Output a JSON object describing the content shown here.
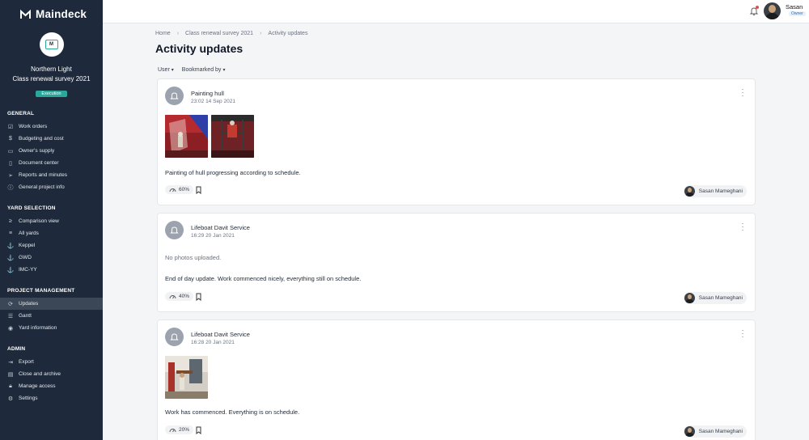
{
  "app": {
    "brand": "Maindeck"
  },
  "project": {
    "ship": "Northern Light",
    "name": "Class renewal survey 2021",
    "status": "Execution",
    "avatar_letter": "M"
  },
  "sidebar": {
    "sections": [
      {
        "heading": "GENERAL",
        "items": [
          {
            "label": "Work orders",
            "icon": "checkbox-icon"
          },
          {
            "label": "Budgeting and cost",
            "icon": "dollar-icon"
          },
          {
            "label": "Owner's supply",
            "icon": "truck-icon"
          },
          {
            "label": "Document center",
            "icon": "folder-icon"
          },
          {
            "label": "Reports and minutes",
            "icon": "send-icon"
          },
          {
            "label": "General project info",
            "icon": "info-icon"
          }
        ]
      },
      {
        "heading": "YARD SELECTION",
        "items": [
          {
            "label": "Comparison view",
            "icon": "compare-icon"
          },
          {
            "label": "All yards",
            "icon": "list-icon"
          },
          {
            "label": "Keppel",
            "icon": "anchor-icon"
          },
          {
            "label": "GWD",
            "icon": "anchor-icon"
          },
          {
            "label": "IMC-YY",
            "icon": "anchor-icon"
          }
        ]
      },
      {
        "heading": "PROJECT MANAGEMENT",
        "items": [
          {
            "label": "Updates",
            "icon": "refresh-icon",
            "active": true
          },
          {
            "label": "Gantt",
            "icon": "gantt-icon"
          },
          {
            "label": "Yard information",
            "icon": "location-icon"
          }
        ]
      },
      {
        "heading": "ADMIN",
        "items": [
          {
            "label": "Export",
            "icon": "export-icon"
          },
          {
            "label": "Close and archive",
            "icon": "archive-icon"
          },
          {
            "label": "Manage access",
            "icon": "lock-icon"
          },
          {
            "label": "Settings",
            "icon": "settings-icon"
          }
        ]
      }
    ]
  },
  "topbar": {
    "user_name": "Sasan",
    "user_role": "Owner",
    "notification_dot_color": "#e05252"
  },
  "breadcrumb": [
    "Home",
    "Class renewal survey 2021",
    "Activity updates"
  ],
  "page": {
    "title": "Activity updates"
  },
  "filters": [
    {
      "label": "User"
    },
    {
      "label": "Bookmarked by"
    }
  ],
  "updates": [
    {
      "title": "Painting hull",
      "time": "23:02 14 Sep 2021",
      "photos": [
        "hull-painting-photo",
        "hull-painting-photo"
      ],
      "text": "Painting of hull progressing according to schedule.",
      "progress": "60%",
      "author": "Sasan Mameghani"
    },
    {
      "title": "Lifeboat Davit Service",
      "time": "16:29 20 Jan 2021",
      "photos": [],
      "no_photos_text": "No photos uploaded.",
      "text": "End of day update. Work commenced nicely, everything still on schedule.",
      "progress": "40%",
      "author": "Sasan Mameghani"
    },
    {
      "title": "Lifeboat Davit Service",
      "time": "16:28 20 Jan 2021",
      "photos": [
        "lifeboat-davit-photo"
      ],
      "text": "Work has commenced. Everything is on schedule.",
      "progress": "20%",
      "author": "Sasan Mameghani"
    }
  ],
  "colors": {
    "sidebar_bg": "#1e2a3b",
    "accent": "#2aa79b",
    "background": "#f4f5f7"
  }
}
